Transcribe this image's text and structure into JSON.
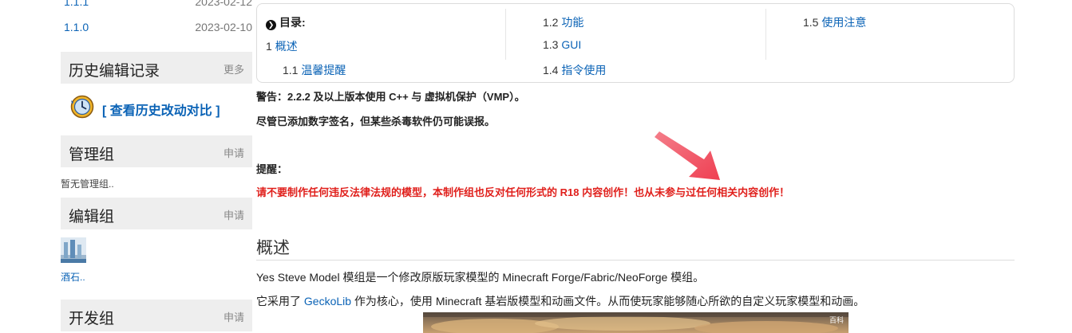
{
  "sidebar": {
    "versions": [
      {
        "version": "1.1.1",
        "date": "2023-02-12"
      },
      {
        "version": "1.1.0",
        "date": "2023-02-10"
      }
    ],
    "history": {
      "title": "历史编辑记录",
      "more": "更多",
      "compare_label": "[ 查看历史改动对比 ]"
    },
    "admins": {
      "title": "管理组",
      "action": "申请",
      "empty_text": "暂无管理组.."
    },
    "editors": {
      "title": "编辑组",
      "action": "申请",
      "member_name": "酒石.."
    },
    "developers": {
      "title": "开发组",
      "action": "申请"
    }
  },
  "toc": {
    "title": "目录:",
    "items": [
      {
        "num": "1",
        "label": "概述"
      },
      {
        "num": "1.1",
        "label": "温馨提醒"
      },
      {
        "num": "1.2",
        "label": "功能"
      },
      {
        "num": "1.3",
        "label": "GUI"
      },
      {
        "num": "1.4",
        "label": "指令使用"
      },
      {
        "num": "1.5",
        "label": "使用注意"
      }
    ]
  },
  "notice": {
    "warning_line": "警告：2.2.2 及以上版本使用 C++ 与 虚拟机保护（VMP）。",
    "signature_line": "尽管已添加数字签名，但某些杀毒软件仍可能误报。",
    "reminder_label": "提醒：",
    "reminder_text": "请不要制作任何违反法律法规的模型，本制作组也反对任何形式的 R18 内容创作！也从未参与过任何相关内容创作！"
  },
  "overview": {
    "heading": "概述",
    "para1": "Yes Steve Model 模组是一个修改原版玩家模型的 Minecraft Forge/Fabric/NeoForge 模组。",
    "para2_prefix": "它采用了 ",
    "para2_link": "GeckoLib",
    "para2_suffix": " 作为核心，使用 Minecraft 基岩版模型和动画文件。从而使玩家能够随心所欲的自定义玩家模型和动画。",
    "image_watermark": "百科"
  },
  "colors": {
    "link": "#0b63b6",
    "alert_red": "#e0201c",
    "arrow": "#f04a5c",
    "panel_gray": "#eeeeee"
  }
}
